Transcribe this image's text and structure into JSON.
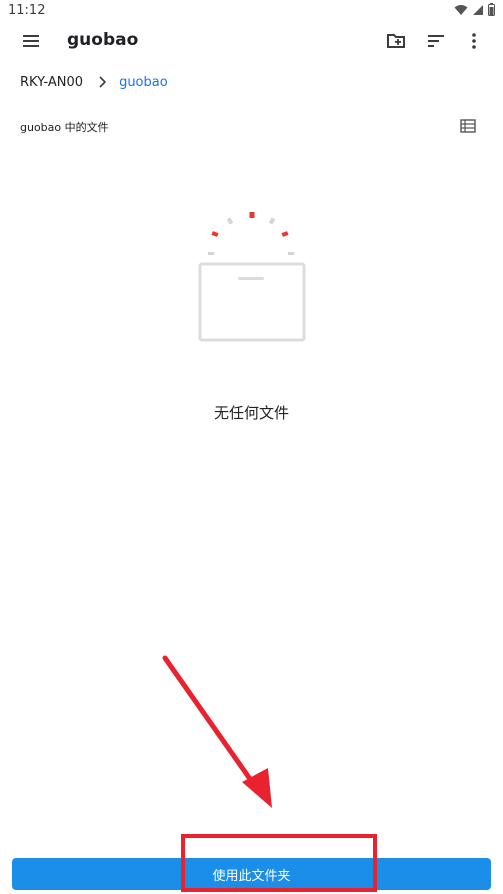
{
  "status_bar": {
    "time": "11:12",
    "icons": [
      "wifi-icon",
      "signal-icon",
      "battery-icon"
    ]
  },
  "toolbar": {
    "title": "guobao",
    "icons": [
      "menu-icon",
      "new-folder-icon",
      "sort-icon",
      "more-options-icon"
    ]
  },
  "breadcrumb": {
    "root": "RKY-AN00",
    "current": "guobao"
  },
  "section": {
    "header": "guobao 中的文件",
    "view_icon": "list-view-icon"
  },
  "empty_state": {
    "message": "无任何文件"
  },
  "action_button": {
    "label": "使用此文件夹"
  },
  "colors": {
    "accent": "#1a73e8",
    "button": "#1a8ee8",
    "annotation_red": "#e8232f"
  }
}
